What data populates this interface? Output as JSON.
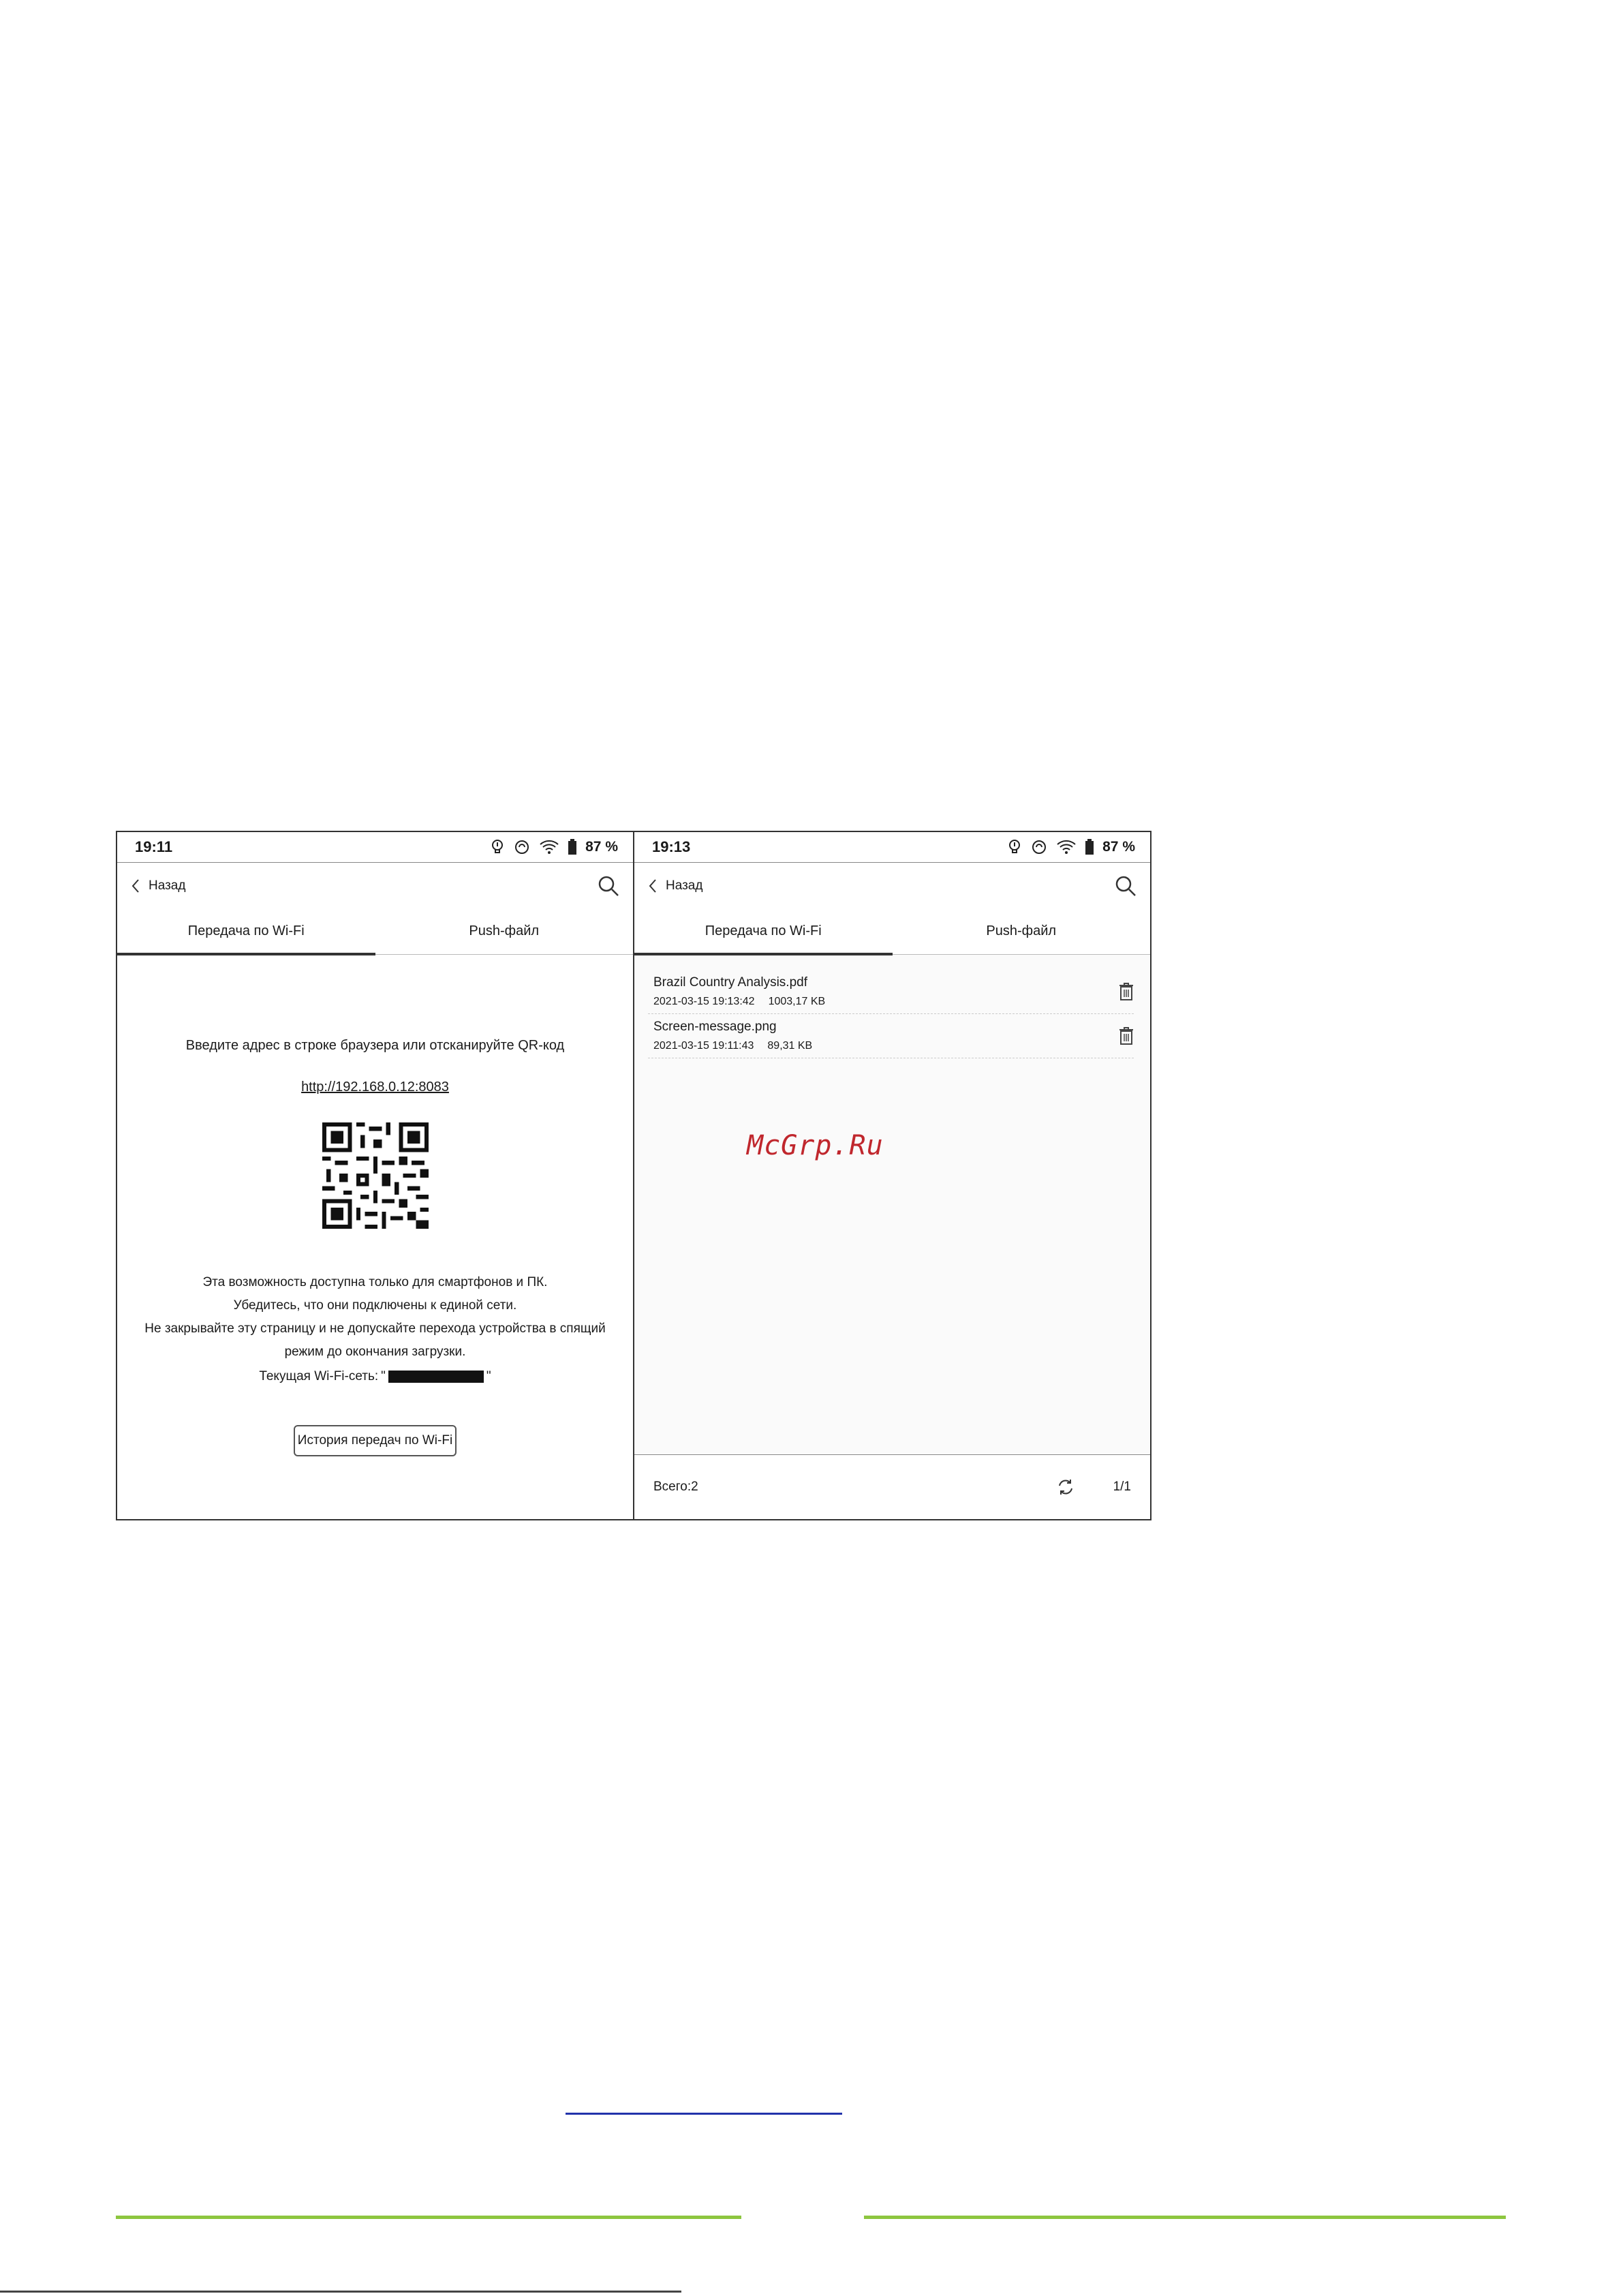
{
  "left_screen": {
    "status": {
      "time": "19:11",
      "battery": "87 %"
    },
    "nav": {
      "back_label": "Назад"
    },
    "tabs": [
      {
        "label": "Передача по Wi-Fi",
        "active": true
      },
      {
        "label": "Push-файл",
        "active": false
      }
    ],
    "instruction": "Введите адрес в строке браузера или отсканируйте QR-код",
    "url": "http://192.168.0.12:8083",
    "notes": [
      "Эта возможность доступна только для смартфонов и ПК.",
      "Убедитесь, что они подключены к единой сети.",
      "Не закрывайте эту страницу и не допускайте перехода устройства в спящий",
      "режим до окончания загрузки."
    ],
    "network_label": "Текущая Wi-Fi-сеть: ",
    "network_quote_open": "\"",
    "network_quote_close": "\"",
    "history_button": "История передач по Wi-Fi"
  },
  "right_screen": {
    "status": {
      "time": "19:13",
      "battery": "87 %"
    },
    "nav": {
      "back_label": "Назад"
    },
    "tabs": [
      {
        "label": "Передача по Wi-Fi",
        "active": true
      },
      {
        "label": "Push-файл",
        "active": false
      }
    ],
    "files": [
      {
        "name": "Brazil Country Analysis.pdf",
        "date": "2021-03-15 19:13:42",
        "size": "1003,17 KB"
      },
      {
        "name": "Screen-message.png",
        "date": "2021-03-15 19:11:43",
        "size": "89,31 KB"
      }
    ],
    "footer": {
      "total": "Всего:2",
      "page": "1/1"
    }
  },
  "watermark": "McGrp.Ru",
  "colors": {
    "accent_green": "#8dc63f",
    "watermark_red": "#c0272d",
    "link_blue": "#2233aa"
  },
  "icons": [
    "back-chevron-icon",
    "search-icon",
    "bulb-icon",
    "sync-icon",
    "wifi-icon",
    "battery-icon",
    "trash-icon",
    "refresh-icon"
  ]
}
